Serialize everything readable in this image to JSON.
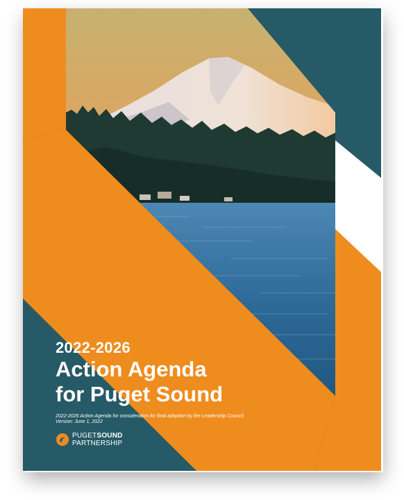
{
  "cover": {
    "year_range": "2022-2026",
    "title_line1": "Action Agenda",
    "title_line2": "for Puget Sound",
    "subtitle_line1": "2022-2026 Action Agenda for consideration for final adoption by the Leadership Council",
    "subtitle_line2": "Version: June 1, 2022"
  },
  "logo": {
    "word1": "PUGET",
    "word2": "SOUND",
    "word3": "PARTNERSHIP",
    "icon": "puget-sound-partnership-logo"
  },
  "colors": {
    "teal": "#265a66",
    "orange": "#ef8c1e",
    "white": "#ffffff"
  }
}
